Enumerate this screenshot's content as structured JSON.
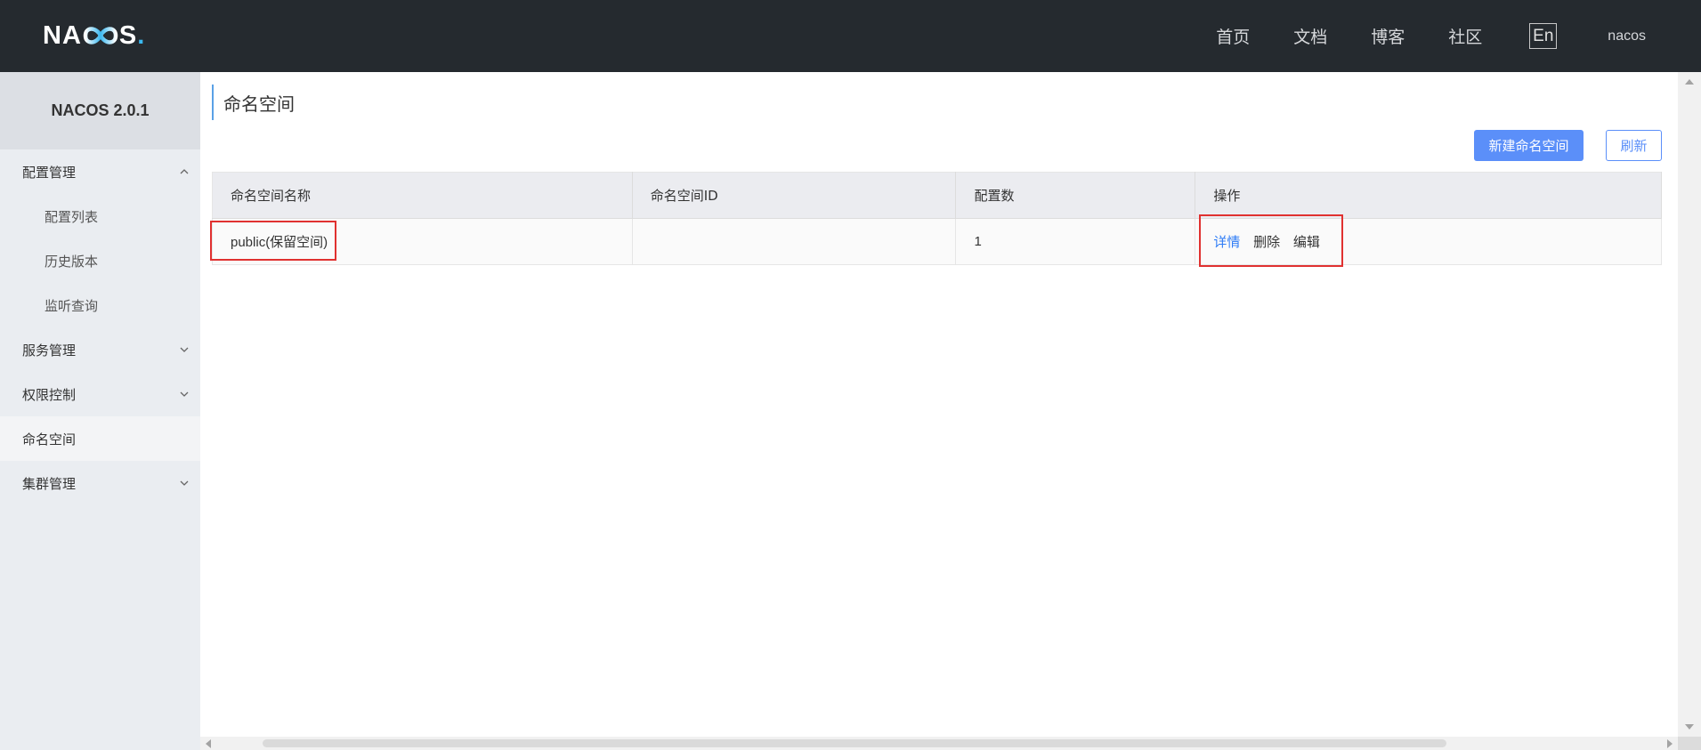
{
  "header": {
    "logo": {
      "pre": "NA",
      "post": "S",
      "dot": "."
    },
    "nav": [
      {
        "label": "首页"
      },
      {
        "label": "文档"
      },
      {
        "label": "博客"
      },
      {
        "label": "社区"
      }
    ],
    "lang_switch": "En",
    "user": "nacos"
  },
  "sidebar": {
    "title": "NACOS 2.0.1",
    "menu": [
      {
        "label": "配置管理",
        "expanded": true
      },
      {
        "label": "配置列表"
      },
      {
        "label": "历史版本"
      },
      {
        "label": "监听查询"
      },
      {
        "label": "服务管理",
        "expanded": false
      },
      {
        "label": "权限控制",
        "expanded": false
      },
      {
        "label": "命名空间",
        "active": true
      },
      {
        "label": "集群管理",
        "expanded": false
      }
    ]
  },
  "main": {
    "title": "命名空间",
    "buttons": {
      "create": "新建命名空间",
      "refresh": "刷新"
    },
    "table": {
      "columns": [
        "命名空间名称",
        "命名空间ID",
        "配置数",
        "操作"
      ],
      "rows": [
        {
          "name": "public(保留空间)",
          "id": "",
          "config_count": "1",
          "actions": [
            "详情",
            "删除",
            "编辑"
          ]
        }
      ]
    }
  },
  "colors": {
    "header_bg": "#252a2f",
    "sidebar_bg": "#eaedf1",
    "primary": "#5b8ff9",
    "link": "#2e7cf6",
    "highlight": "#e03130"
  }
}
